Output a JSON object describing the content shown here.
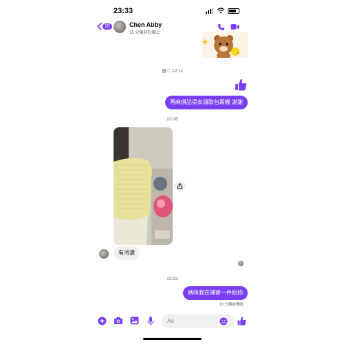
{
  "status_bar": {
    "time": "23:33"
  },
  "header": {
    "back_badge": "10",
    "contact_name": "Chen Abby",
    "contact_status": "15 分鐘前在線上"
  },
  "messages": {
    "timestamp_1": "週二 12:11",
    "outgoing_1": "再麻煩記得去領取包裹喔 謝謝",
    "timestamp_2": "22:26",
    "incoming_1": "有污漬",
    "timestamp_3": "23:23",
    "outgoing_2": "媽咪我在補寄一件給妳",
    "delivered_status": "10 分鐘前傳送"
  },
  "composer": {
    "placeholder": "Aa"
  },
  "colors": {
    "accent": "#7b3ff2",
    "incoming_bubble": "#f0f0f0"
  },
  "icons": [
    "back-chevron-icon",
    "phone-icon",
    "video-camera-icon",
    "thumbs-up-icon",
    "share-icon",
    "plus-icon",
    "camera-icon",
    "image-icon",
    "microphone-icon",
    "emoji-icon"
  ]
}
